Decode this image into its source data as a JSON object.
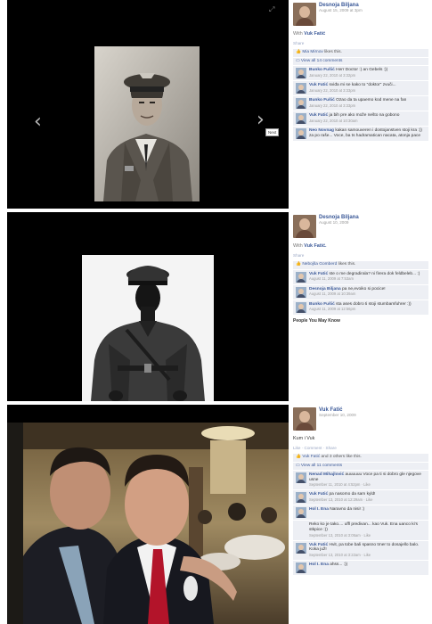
{
  "panels": [
    {
      "owner": {
        "name": "Desnoja Biljana",
        "date": "August 15, 2009 at 3pm"
      },
      "with_label": "With",
      "with_name": "Vuk Fatić",
      "share": "Share",
      "likes_name": "Mia Mirnov",
      "likes_text": "likes this.",
      "view_all": "View all 14 comments",
      "next_label": "Next",
      "comments": [
        {
          "name": "Bunko Fušić",
          "text": "Herr Doctor :) an Gebels :))",
          "date": "January 22, 2010 at 3:32pm"
        },
        {
          "name": "Vuk Fatić",
          "text": "sviđa mi se kako to \"doktor\" zvuči...",
          "date": "January 22, 2010 at 3:33pm"
        },
        {
          "name": "Bunko Fušić",
          "text": "Ozao da ta upaemo kod mene na fan",
          "date": "January 22, 2010 at 3:33pm"
        },
        {
          "name": "Vuk Fatić",
          "text": "ja bih pre ako može nešto na gobono",
          "date": "January 22, 2010 at 10:30am"
        },
        {
          "name": "Neo Novnag",
          "text": "kakan samouveren i dostojanstven stoji kra :)) za po raše... Voce, ba ts hadramatican nacata, atonja pace",
          "date": ""
        }
      ]
    },
    {
      "owner": {
        "name": "Desnoja Biljana",
        "date": "August 10, 2009"
      },
      "with_label": "With",
      "with_name": "Vuk Fatić.",
      "share": "Share",
      "likes_name": "Nebojša Gomberd",
      "likes_text": "likes this.",
      "comments": [
        {
          "name": "Vuk Fatić",
          "text": "ste o me degradirala? ni firera dok feldbeleb... :)",
          "date": "August 11, 2009 at 7:53am"
        },
        {
          "name": "Desnoja Biljana",
          "text": "pa ne,evoiko si pocice!",
          "date": "August 11, 2009 at 10:39am"
        },
        {
          "name": "Bunko Fušić",
          "text": "sta ases dobro ti stoji stumbamfuhrer :))",
          "date": "August 11, 2009 at 12:56pm"
        }
      ],
      "people_label": "People You May Know"
    },
    {
      "owner": {
        "name": "Vuk Fatić",
        "date": "September 10, 2009"
      },
      "caption": "Kum i Vuk",
      "actions": "Like · Comment · Share",
      "likes_name": "Vuk Fatić",
      "likes_text": "and 3 others like this.",
      "view_all": "View all 11 comments",
      "comments": [
        {
          "name": "Nenad Mihajlović",
          "text": "auuuuuu Voce pa ti si dobro gle njegove usne",
          "date": "September 11, 2010 at 4:52pm · Like"
        },
        {
          "name": "Vuk Fatić",
          "text": "pa nasomo da sam kyld!",
          "date": "September 13, 2010 at 12:29am · Like"
        },
        {
          "name": "Hol I. Ena",
          "text": "Naravno da nisi! :)",
          "date": ""
        },
        {
          "name": "",
          "text": "Reko ko je tako.... uffl predivan... kao Vuk. Ena uanco ki's stkpice :))",
          "date": "September 13, 2010 at 3:05am · Like"
        },
        {
          "name": "Vuk Fatić",
          "text": "Hvit, pa tobe bali spasno tmer to dosajello balo. Koka juž!",
          "date": "September 13, 2010 at 3:22am · Like"
        },
        {
          "name": "Hol I. Ena",
          "text": "ahss... :))",
          "date": ""
        }
      ]
    }
  ]
}
